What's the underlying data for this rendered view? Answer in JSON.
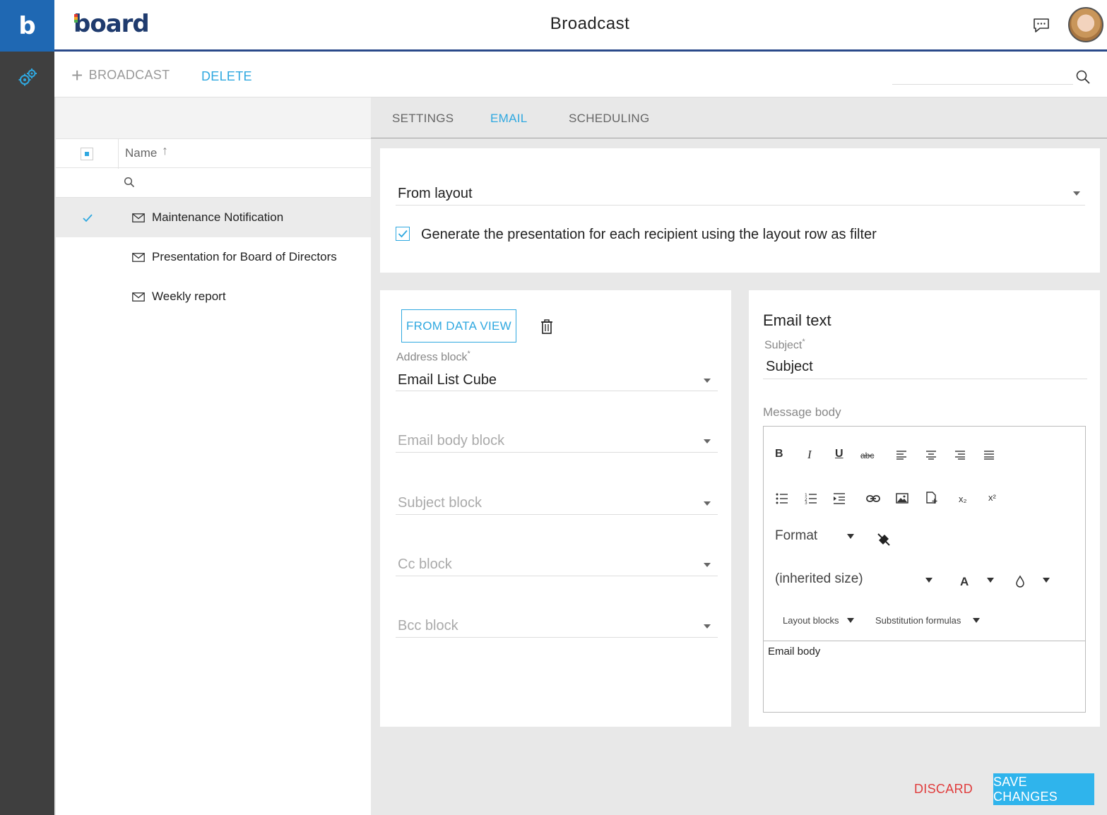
{
  "app": {
    "logo_letter": "b",
    "brand": "board",
    "page_title": "Broadcast",
    "icons": {
      "settings": "gear-icon",
      "chat": "chat-icon",
      "search": "search-icon"
    }
  },
  "toolbar": {
    "add_label": "BROADCAST",
    "delete_label": "DELETE",
    "search_placeholder": ""
  },
  "list": {
    "column_name": "Name",
    "sort_indicator": "↑",
    "items": [
      {
        "label": "Maintenance Notification",
        "selected": true
      },
      {
        "label": "Presentation for Board of Directors",
        "selected": false
      },
      {
        "label": "Weekly report",
        "selected": false
      }
    ]
  },
  "tabs": [
    {
      "label": "SETTINGS",
      "active": false
    },
    {
      "label": "EMAIL",
      "active": true
    },
    {
      "label": "SCHEDULING",
      "active": false
    }
  ],
  "layout_section": {
    "source_value": "From layout",
    "filter_checkbox_label": "Generate the presentation for each recipient using the layout row as filter",
    "filter_checked": true
  },
  "blocks": {
    "from_button": "FROM DATA VIEW",
    "address_label": "Address block",
    "required_mark": "*",
    "address_value": "Email List Cube",
    "email_body_placeholder": "Email body block",
    "subject_placeholder": "Subject block",
    "cc_placeholder": "Cc block",
    "bcc_placeholder": "Bcc block"
  },
  "email_text": {
    "title": "Email text",
    "subject_label": "Subject",
    "subject_value": "Subject",
    "message_label": "Message body",
    "editor": {
      "bold": "B",
      "italic": "I",
      "underline": "U",
      "strike": "abc",
      "subscript": "x₂",
      "superscript": "x²",
      "format": "Format",
      "size": "(inherited size)",
      "font_color": "A",
      "layout_blocks": "Layout blocks",
      "substitution_formulas": "Substitution formulas",
      "body": "Email body"
    }
  },
  "actions": {
    "discard": "DISCARD",
    "save": "SAVE CHANGES"
  },
  "colors": {
    "accent": "#2fa8e0",
    "danger": "#e03c3c",
    "rail": "#3f3f3f",
    "rail_logo": "#1f68b3"
  }
}
